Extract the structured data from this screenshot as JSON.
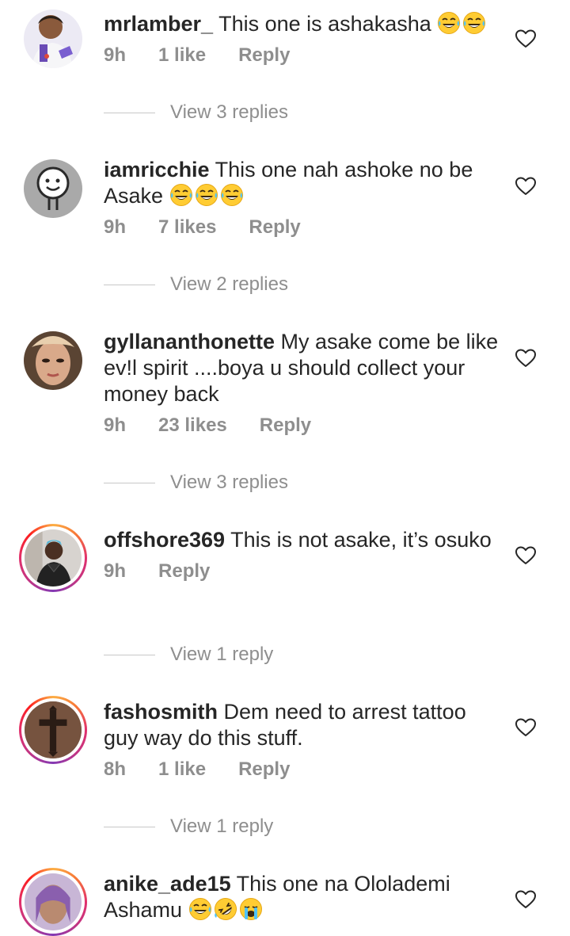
{
  "comments": [
    {
      "username": "mrlamber_",
      "text": "This one is ashakasha",
      "emojis": [
        "joy",
        "joy"
      ],
      "time": "9h",
      "likes": "1 like",
      "reply_label": "Reply",
      "view_replies": "View 3 replies"
    },
    {
      "username": "iamricchie",
      "text": "This one nah ashoke no be Asake",
      "emojis": [
        "joy",
        "joy",
        "joy"
      ],
      "time": "9h",
      "likes": "7 likes",
      "reply_label": "Reply",
      "view_replies": "View 2 replies"
    },
    {
      "username": "gyllananthonette",
      "text": "My asake come be like ev!l spirit ....boya u should collect your money back",
      "emojis": [],
      "time": "9h",
      "likes": "23 likes",
      "reply_label": "Reply",
      "view_replies": "View 3 replies"
    },
    {
      "username": "offshore369",
      "text": "This is not asake, it’s osuko",
      "emojis": [],
      "time": "9h",
      "likes": "",
      "reply_label": "Reply",
      "view_replies": "View 1 reply"
    },
    {
      "username": "fashosmith",
      "text": "Dem need to arrest tattoo guy way do this stuff.",
      "emojis": [],
      "time": "8h",
      "likes": "1 like",
      "reply_label": "Reply",
      "view_replies": "View 1 reply"
    },
    {
      "username": "anike_ade15",
      "text": "This one na Ololademi Ashamu",
      "emojis": [
        "joy",
        "rofl",
        "sob"
      ],
      "time": "",
      "likes": "",
      "reply_label": "",
      "view_replies": ""
    }
  ],
  "icons": {
    "like": "heart-outline-icon",
    "emoji_joy": "face-with-tears-of-joy",
    "emoji_rofl": "rolling-on-floor-laughing",
    "emoji_sob": "loudly-crying-face"
  },
  "colors": {
    "text": "#262626",
    "secondary": "#8e8e8e",
    "divider": "#c7c7c7",
    "story_ring": [
      "#fcaf45",
      "#f77737",
      "#e1306c",
      "#c13584",
      "#833ab4"
    ],
    "emoji_yellow": "#ffcc33"
  }
}
